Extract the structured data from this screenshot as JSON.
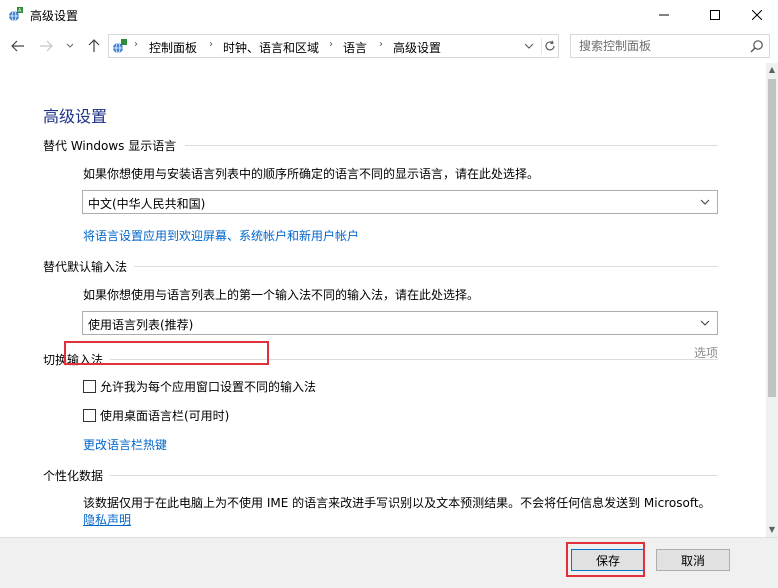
{
  "window": {
    "title": "高级设置"
  },
  "nav": {
    "breadcrumbs": [
      "控制面板",
      "时钟、语言和区域",
      "语言",
      "高级设置"
    ]
  },
  "search": {
    "placeholder": "搜索控制面板"
  },
  "page": {
    "title": "高级设置",
    "sections": {
      "display_language": {
        "heading": "替代 Windows 显示语言",
        "description": "如果你想使用与安装语言列表中的顺序所确定的语言不同的显示语言，请在此处选择。",
        "select_value": "中文(中华人民共和国)",
        "link": "将语言设置应用到欢迎屏幕、系统帐户和新用户帐户"
      },
      "input_method": {
        "heading": "替代默认输入法",
        "description": "如果你想使用与语言列表上的第一个输入法不同的输入法，请在此处选择。",
        "select_value": "使用语言列表(推荐)"
      },
      "switch_input": {
        "heading": "切换输入法",
        "checkbox_per_app": "允许我为每个应用窗口设置不同的输入法",
        "checkbox_per_app_checked": false,
        "checkbox_language_bar": "使用桌面语言栏(可用时)",
        "checkbox_language_bar_checked": false,
        "options_label": "选项",
        "hotkey_link": "更改语言栏热键"
      },
      "personalization": {
        "heading": "个性化数据",
        "description": "该数据仅用于在此电脑上为不使用 IME 的语言来改进手写识别以及文本预测结果。不会将任何信息发送到 Microsoft。",
        "privacy_link": "隐私声明"
      }
    }
  },
  "footer": {
    "save_label": "保存",
    "cancel_label": "取消"
  },
  "colors": {
    "title_blue": "#1e3287",
    "link_blue": "#0066cc",
    "highlight_red": "#e0303a"
  }
}
